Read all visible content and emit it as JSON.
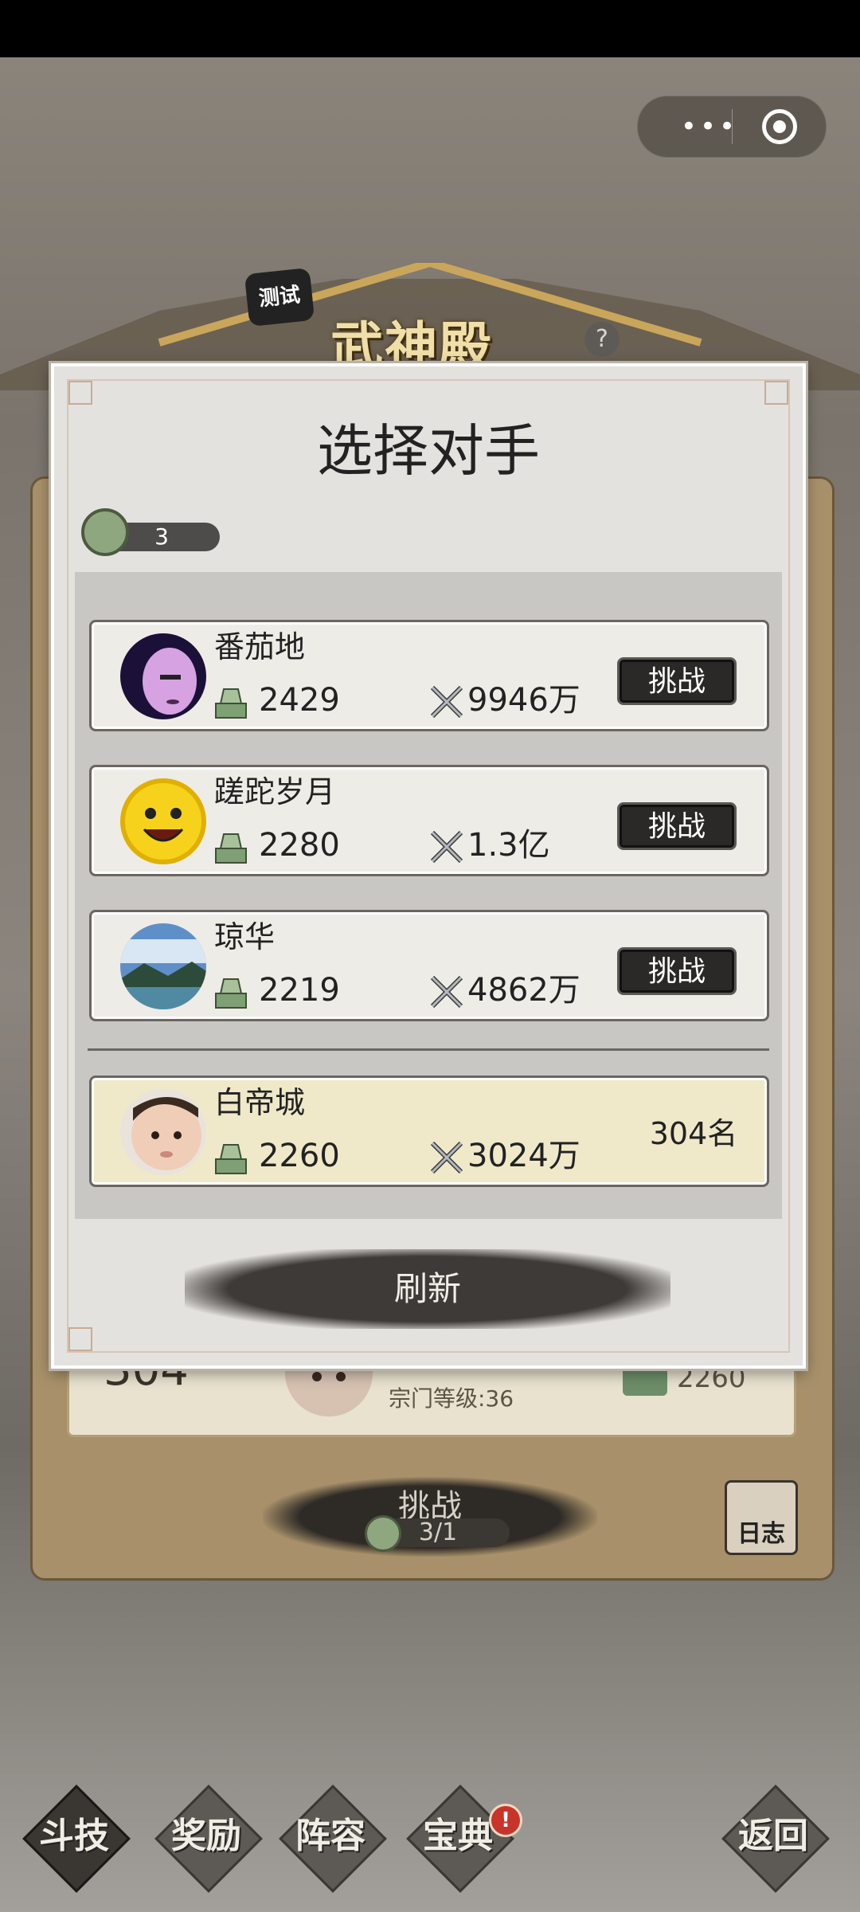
{
  "top_bar": {
    "more_glyph": "•••",
    "hall_title": "武神殿",
    "test_badge": "测试",
    "help_glyph": "?"
  },
  "background_panel": {
    "rank": "304",
    "sect_level": "宗门等级:36",
    "score": "2260",
    "challenge_label": "挑战",
    "challenge_count": "3/1",
    "log_label": "日志"
  },
  "modal": {
    "title": "选择对手",
    "ticket_count": "3",
    "refresh_label": "刷新",
    "challenge_label": "挑战",
    "opponents": [
      {
        "name": "番茄地",
        "score": "2429",
        "power": "9946万"
      },
      {
        "name": "蹉跎岁月",
        "score": "2280",
        "power": "1.3亿"
      },
      {
        "name": "琼华",
        "score": "2219",
        "power": "4862万"
      }
    ],
    "self": {
      "name": "白帝城",
      "score": "2260",
      "power": "3024万",
      "rank": "304名"
    }
  },
  "bottom_nav": {
    "items": [
      {
        "label": "斗技",
        "active": true
      },
      {
        "label": "奖励",
        "active": false
      },
      {
        "label": "阵容",
        "active": false
      },
      {
        "label": "宝典",
        "active": false
      },
      {
        "label": "返回",
        "active": false
      }
    ],
    "badge": "!"
  },
  "colors": {
    "accent_dark": "#2a2928",
    "card_bg": "#eeece6",
    "self_card_bg": "#efe9c9",
    "badge_red": "#c8342c"
  }
}
